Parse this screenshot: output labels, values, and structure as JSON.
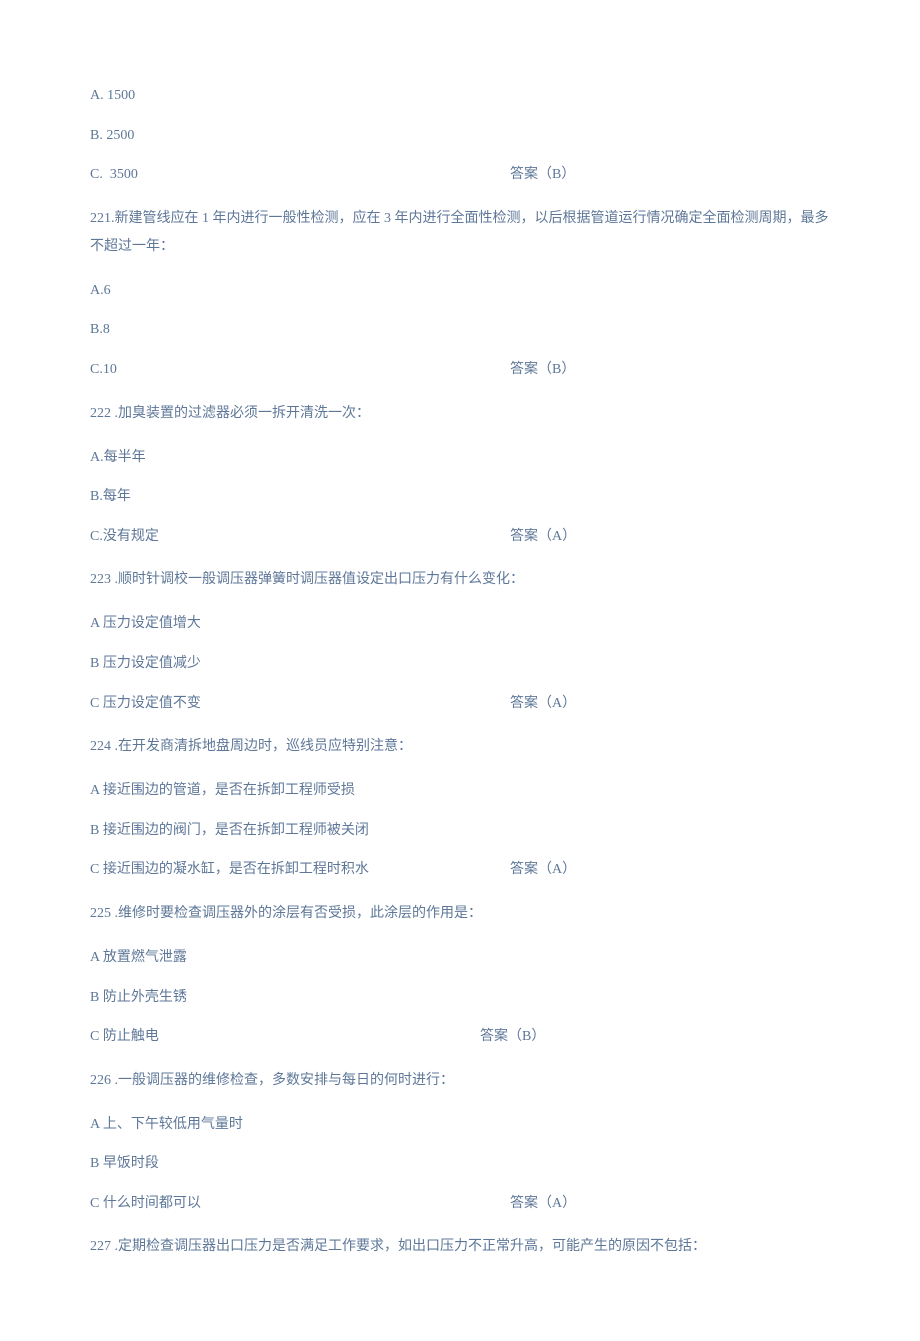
{
  "preOptions": {
    "a": "A.  1500",
    "b": "B.  2500",
    "c": "C.  3500",
    "answer": "答案（B）"
  },
  "q221": {
    "stem": "221.新建管线应在 1 年内进行一般性检测，应在 3 年内进行全面性检测，以后根据管道运行情况确定全面检测周期，最多不超过一年：",
    "a": "A.6",
    "b": "B.8",
    "c": "C.10",
    "answer": "答案（B）"
  },
  "q222": {
    "stem": "222   .加臭装置的过滤器必须一拆开清洗一次：",
    "a": "A.每半年",
    "b": "B.每年",
    "c": "C.没有规定",
    "answer": "答案（A）"
  },
  "q223": {
    "stem": "223   .顺时针调校一般调压器弹簧时调压器值设定出口压力有什么变化：",
    "a": "A 压力设定值增大",
    "b": "B 压力设定值减少",
    "c": "C 压力设定值不变",
    "answer": "答案（A）"
  },
  "q224": {
    "stem": "224   .在开发商清拆地盘周边时，巡线员应特别注意：",
    "a": "A 接近围边的管道，是否在拆卸工程师受损",
    "b": "B 接近围边的阀门，是否在拆卸工程师被关闭",
    "c": "C 接近围边的凝水缸，是否在拆卸工程时积水",
    "answer": "答案（A）"
  },
  "q225": {
    "stem": "225   .维修时要检查调压器外的涂层有否受损，此涂层的作用是：",
    "a": " A 放置燃气泄露",
    "b": "B 防止外壳生锈",
    "c": "C 防止触电",
    "answer": "答案（B）"
  },
  "q226": {
    "stem": "226   .一般调压器的维修检查，多数安排与每日的何时进行：",
    "a": "A 上、下午较低用气量时",
    "b": "B 早饭时段",
    "c": "C 什么时间都可以",
    "answer": "答案（A）"
  },
  "q227": {
    "stem": "227   .定期检查调压器出口压力是否满足工作要求，如出口压力不正常升高，可能产生的原因不包括："
  }
}
